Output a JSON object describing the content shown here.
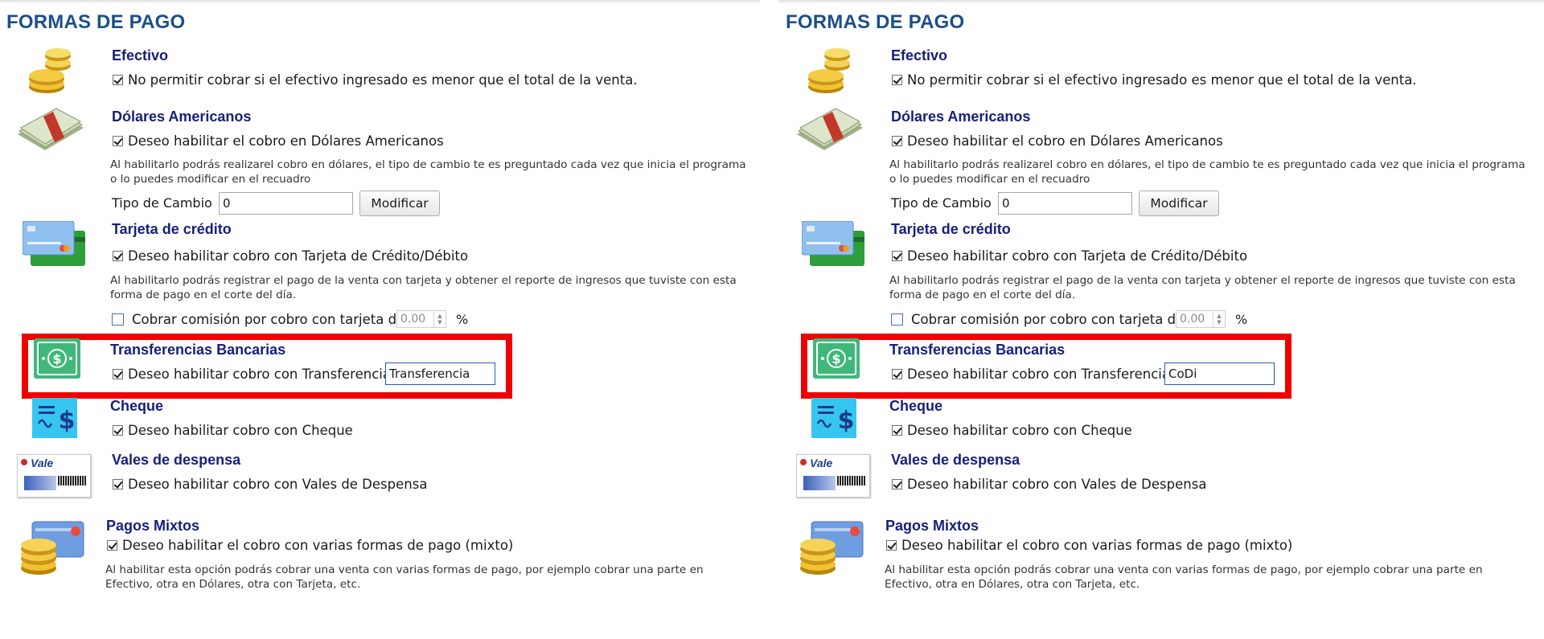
{
  "panels": [
    {
      "title": "FORMAS DE PAGO",
      "efectivo": {
        "title": "Efectivo",
        "option": "No permitir cobrar si el efectivo ingresado es menor que el total de la venta."
      },
      "dolares": {
        "title": "Dólares Americanos",
        "option": "Deseo habilitar el cobro en Dólares Americanos",
        "desc_line1": "Al habilitarlo podrás realizarel cobro en dólares, el tipo de cambio te es preguntado cada vez que inicia el programa",
        "desc_line2": "o lo puedes modificar en el recuadro",
        "rate_label": "Tipo de Cambio",
        "rate_value": "0",
        "modify_label": "Modificar"
      },
      "tarjeta": {
        "title": "Tarjeta de crédito",
        "option": "Deseo habilitar cobro con Tarjeta de Crédito/Débito",
        "desc_line1": "Al habilitarlo podrás registrar el pago de la venta con tarjeta y obtener el reporte de ingresos que tuviste con esta",
        "desc_line2": "forma de pago en el corte del día.",
        "commission_label": "Cobrar comisión por cobro con tarjeta del",
        "commission_value": "0.00",
        "percent": "%"
      },
      "transferencias": {
        "title": "Transferencias Bancarias",
        "option": "Deseo habilitar cobro con Transferencias y",
        "name_value": "Transferencia"
      },
      "cheque": {
        "title": "Cheque",
        "option": "Deseo habilitar cobro con Cheque"
      },
      "vales": {
        "title": "Vales de despensa",
        "option": "Deseo habilitar cobro con Vales de Despensa",
        "card_text": "Vale"
      },
      "mixtos": {
        "title": "Pagos Mixtos",
        "option": "Deseo habilitar el cobro con varias formas de pago (mixto)",
        "desc_line1": "Al habilitar esta opción podrás cobrar una venta con varias formas de pago, por ejemplo cobrar una parte en",
        "desc_line2": "Efectivo, otra en Dólares, otra con Tarjeta, etc."
      }
    },
    {
      "title": "FORMAS DE PAGO",
      "efectivo": {
        "title": "Efectivo",
        "option": "No permitir cobrar si el efectivo ingresado es menor que el total de la venta."
      },
      "dolares": {
        "title": "Dólares Americanos",
        "option": "Deseo habilitar el cobro en Dólares Americanos",
        "desc_line1": "Al habilitarlo podrás realizarel cobro en dólares, el tipo de cambio te es preguntado cada vez que inicia el programa",
        "desc_line2": "o lo puedes modificar en el recuadro",
        "rate_label": "Tipo de Cambio",
        "rate_value": "0",
        "modify_label": "Modificar"
      },
      "tarjeta": {
        "title": "Tarjeta de crédito",
        "option": "Deseo habilitar cobro con Tarjeta de Crédito/Débito",
        "desc_line1": "Al habilitarlo podrás registrar el pago de la venta con tarjeta y obtener el reporte de ingresos que tuviste con esta",
        "desc_line2": "forma de pago en el corte del día.",
        "commission_label": "Cobrar comisión por cobro con tarjeta del",
        "commission_value": "0.00",
        "percent": "%"
      },
      "transferencias": {
        "title": "Transferencias Bancarias",
        "option": "Deseo habilitar cobro con Transferencias y",
        "name_value": "CoDi"
      },
      "cheque": {
        "title": "Cheque",
        "option": "Deseo habilitar cobro con Cheque"
      },
      "vales": {
        "title": "Vales de despensa",
        "option": "Deseo habilitar cobro con Vales de Despensa",
        "card_text": "Vale"
      },
      "mixtos": {
        "title": "Pagos Mixtos",
        "option": "Deseo habilitar el cobro con varias formas de pago (mixto)",
        "desc_line1": "Al habilitar esta opción podrás cobrar una venta con varias formas de pago, por ejemplo cobrar una parte en",
        "desc_line2": "Efectivo, otra en Dólares, otra con Tarjeta, etc."
      }
    }
  ],
  "colors": {
    "title": "#1c4f8a",
    "section": "#17207a",
    "highlight": "#ef0000"
  }
}
